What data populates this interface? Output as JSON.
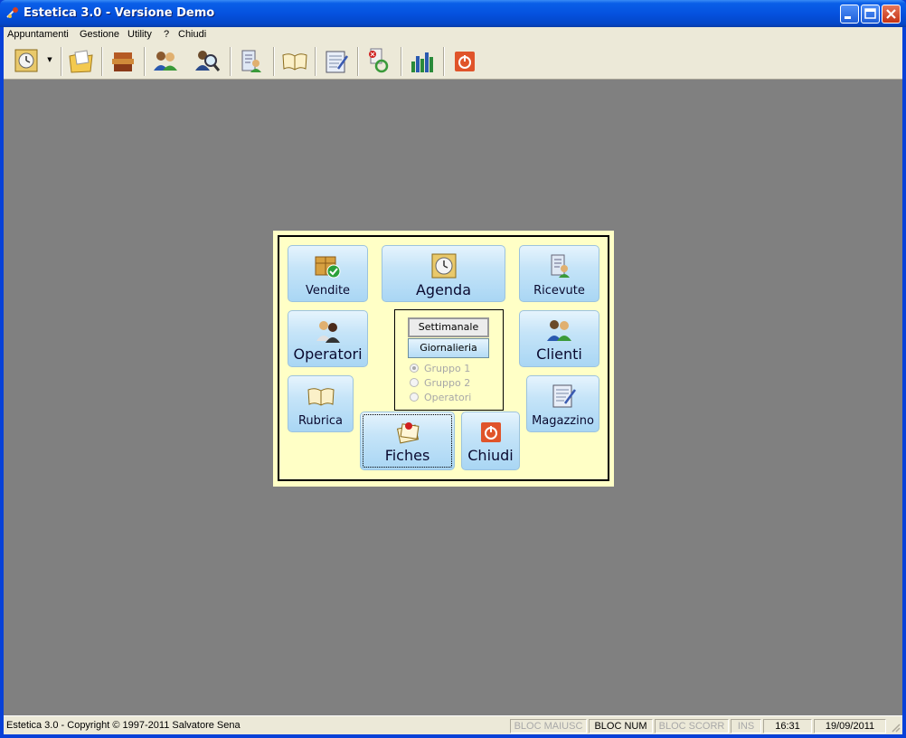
{
  "window": {
    "title": "Estetica 3.0 - Versione Demo",
    "controls": [
      "minimize-icon",
      "maximize-icon",
      "close-icon"
    ]
  },
  "menubar": {
    "items": [
      "Appuntamenti",
      "Gestione",
      "Utility",
      "?",
      "Chiudi"
    ]
  },
  "toolbar": {
    "buttons": [
      "agenda-clock-icon",
      "open-folder-icon",
      "cash-register-icon",
      "users-icon",
      "search-user-icon",
      "receipt-icon",
      "address-book-icon",
      "notepad-icon",
      "delete-sync-icon",
      "bar-chart-icon",
      "power-icon"
    ]
  },
  "panel": {
    "buttons": {
      "vendite": "Vendite",
      "agenda": "Agenda",
      "ricevute": "Ricevute",
      "operatori": "Operatori",
      "clienti": "Clienti",
      "rubrica": "Rubrica",
      "magazzino": "Magazzino",
      "fiches": "Fiches",
      "chiudi": "Chiudi"
    },
    "agenda_options": {
      "settimanale": "Settimanale",
      "giornalieria": "Giornalieria",
      "radios": [
        {
          "label": "Gruppo 1",
          "checked": true
        },
        {
          "label": "Gruppo 2",
          "checked": false
        },
        {
          "label": "Operatori",
          "checked": false
        }
      ]
    }
  },
  "statusbar": {
    "main": "Estetica 3.0 - Copyright © 1997-2011 Salvatore Sena",
    "caps": "BLOC MAIUSC",
    "num": "BLOC NUM",
    "scroll": "BLOC SCORR",
    "ins": "INS",
    "time": "16:31",
    "date": "19/09/2011"
  },
  "colors": {
    "titlebar": "#0552df",
    "mdi_background": "#808080",
    "panel_background": "#ffffc6",
    "button_gradient_top": "#e6f4fd",
    "button_gradient_bottom": "#a9d6f4",
    "chiudi_icon": "#e0542a"
  }
}
